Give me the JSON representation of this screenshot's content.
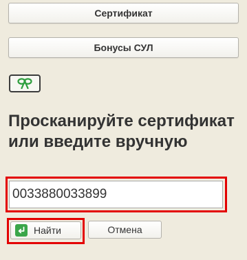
{
  "buttons": {
    "certificate_label": "Сертификат",
    "bonus_label": "Бонусы СУЛ",
    "gift_icon": "gift-bow-icon"
  },
  "prompt": {
    "text": "Просканируйте сертификат или введите вручную"
  },
  "input": {
    "value": "0033880033899",
    "cursor": "|"
  },
  "actions": {
    "find_label": "Найти",
    "find_icon": "enter-arrow-icon",
    "cancel_label": "Отмена"
  },
  "colors": {
    "background": "#efebde",
    "highlight": "#e30000",
    "gift_icon": "#2e9e3e",
    "enter_icon": "#3aa64a"
  }
}
